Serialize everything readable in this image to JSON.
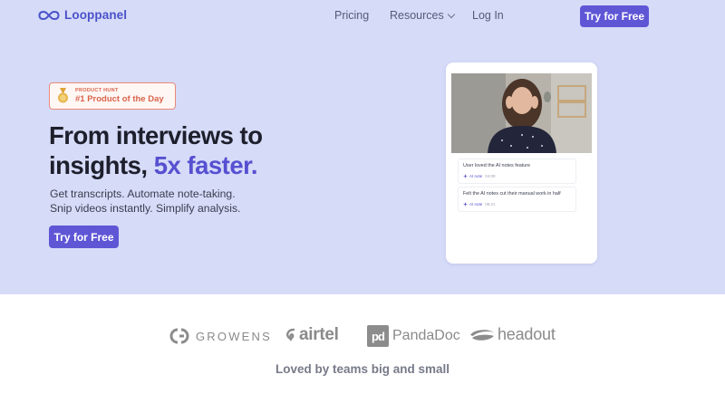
{
  "nav": {
    "brand": "Looppanel",
    "links": [
      "Pricing",
      "Resources",
      "Log In"
    ],
    "cta": "Try for Free"
  },
  "hero": {
    "badge": {
      "small": "PRODUCT HUNT",
      "big": "#1 Product of the Day"
    },
    "headline_line1": "From interviews to",
    "headline_line2_prefix": "insights, ",
    "headline_accent": "5x faster.",
    "sub_line1": "Get transcripts. Automate note-taking.",
    "sub_line2": "Snip videos instantly. Simplify analysis.",
    "cta": "Try for Free"
  },
  "mockup": {
    "notes": [
      {
        "text": "User loved the AI notes feature",
        "tag": "AI note",
        "time": "04:09"
      },
      {
        "text": "Felt the AI notes cut their manual work in half",
        "tag": "AI note",
        "time": "06:21"
      }
    ]
  },
  "logos": [
    "GROWENS",
    "airtel",
    "PandaDoc",
    "headout"
  ],
  "tagline": "Loved by teams big and small",
  "colors": {
    "hero_bg": "#d6dbf8",
    "accent": "#5f56d6",
    "brand": "#4a52c9",
    "badge": "#d9634b"
  }
}
